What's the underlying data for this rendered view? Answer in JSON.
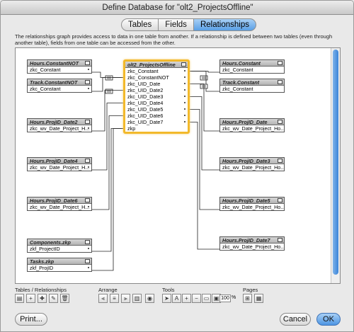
{
  "window": {
    "title": "Define Database for \"olt2_ProjectsOffline\""
  },
  "tabs": [
    {
      "label": "Tables",
      "active": false
    },
    {
      "label": "Fields",
      "active": false
    },
    {
      "label": "Relationships",
      "active": true
    }
  ],
  "description": "The relationships graph provides access to data in one table from another. If a relationship is defined between two tables (even through another table), fields from one table can be accessed from the other.",
  "center_table": {
    "name": "olt2_ProjectsOffline",
    "fields": [
      "zkc_Constant",
      "zkc_ConstantNOT",
      "zkc_UID_Date",
      "zkc_UID_Date2",
      "zkc_UID_Date3",
      "zkc_UID_Date4",
      "zkc_UID_Date5",
      "zkc_UID_Date6",
      "zkc_UID_Date7",
      "zkp"
    ]
  },
  "left_tables": [
    {
      "name": "Hours.ConstantNOT",
      "field": "zkc_Constant"
    },
    {
      "name": "Track.ConstantNOT",
      "field": "zkc_Constant"
    },
    {
      "name": "Hours.ProjID_Date2",
      "field": "zkc_wv_Date_Project_H..."
    },
    {
      "name": "Hours.ProjID_Date4",
      "field": "zkc_wv_Date_Project_H..."
    },
    {
      "name": "Hours.ProjID_Date6",
      "field": "zkc_wv_Date_Project_H..."
    },
    {
      "name": "Components.zkp",
      "field": "zkf_ProjectID"
    },
    {
      "name": "Tasks.zkp",
      "field": "zkf_ProjID"
    }
  ],
  "right_tables": [
    {
      "name": "Hours.Constant",
      "field": "zkc_Constant"
    },
    {
      "name": "Track.Constant",
      "field": "zkc_Constant"
    },
    {
      "name": "Hours.ProjID_Date",
      "field": "zkc_wv_Date_Project_Ho..."
    },
    {
      "name": "Hours.ProjID_Date3",
      "field": "zkc_wv_Date_Project_Ho..."
    },
    {
      "name": "Hours.ProjID_Date5",
      "field": "zkc_wv_Date_Project_Ho..."
    },
    {
      "name": "Hours.ProjID_Date7",
      "field": "zkc_wv_Date_Project_Ho..."
    }
  ],
  "toolbar": {
    "tables_label": "Tables / Relationships",
    "arrange_label": "Arrange",
    "tools_label": "Tools",
    "pages_label": "Pages",
    "zoom_value": "100",
    "zoom_unit": "%"
  },
  "buttons": {
    "print": "Print...",
    "cancel": "Cancel",
    "ok": "OK"
  }
}
